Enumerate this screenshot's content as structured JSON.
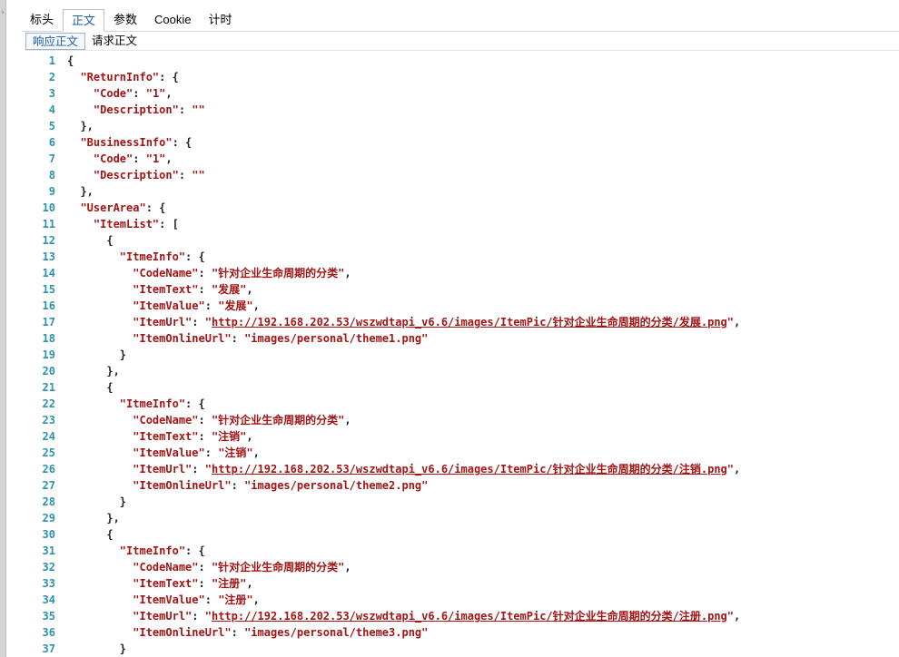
{
  "tabs": [
    {
      "label": "标头",
      "active": false
    },
    {
      "label": "正文",
      "active": true
    },
    {
      "label": "参数",
      "active": false
    },
    {
      "label": "Cookie",
      "active": false
    },
    {
      "label": "计时",
      "active": false
    }
  ],
  "subtabs": [
    {
      "label": "响应正文",
      "active": true
    },
    {
      "label": "请求正文",
      "active": false
    }
  ],
  "colors": {
    "key": "#a31515",
    "string": "#a31515",
    "line_number": "#2b91af",
    "active_tab": "#1e5cad"
  },
  "code_lines": [
    {
      "n": "1",
      "parts": [
        {
          "t": "p",
          "v": "{"
        }
      ]
    },
    {
      "n": "2",
      "parts": [
        {
          "t": "p",
          "v": "  "
        },
        {
          "t": "k",
          "v": "\"ReturnInfo\""
        },
        {
          "t": "p",
          "v": ": {"
        }
      ]
    },
    {
      "n": "3",
      "parts": [
        {
          "t": "p",
          "v": "    "
        },
        {
          "t": "k",
          "v": "\"Code\""
        },
        {
          "t": "p",
          "v": ": "
        },
        {
          "t": "s",
          "v": "\"1\""
        },
        {
          "t": "p",
          "v": ","
        }
      ]
    },
    {
      "n": "4",
      "parts": [
        {
          "t": "p",
          "v": "    "
        },
        {
          "t": "k",
          "v": "\"Description\""
        },
        {
          "t": "p",
          "v": ": "
        },
        {
          "t": "s",
          "v": "\"\""
        }
      ]
    },
    {
      "n": "5",
      "parts": [
        {
          "t": "p",
          "v": "  },"
        }
      ]
    },
    {
      "n": "6",
      "parts": [
        {
          "t": "p",
          "v": "  "
        },
        {
          "t": "k",
          "v": "\"BusinessInfo\""
        },
        {
          "t": "p",
          "v": ": {"
        }
      ]
    },
    {
      "n": "7",
      "parts": [
        {
          "t": "p",
          "v": "    "
        },
        {
          "t": "k",
          "v": "\"Code\""
        },
        {
          "t": "p",
          "v": ": "
        },
        {
          "t": "s",
          "v": "\"1\""
        },
        {
          "t": "p",
          "v": ","
        }
      ]
    },
    {
      "n": "8",
      "parts": [
        {
          "t": "p",
          "v": "    "
        },
        {
          "t": "k",
          "v": "\"Description\""
        },
        {
          "t": "p",
          "v": ": "
        },
        {
          "t": "s",
          "v": "\"\""
        }
      ]
    },
    {
      "n": "9",
      "parts": [
        {
          "t": "p",
          "v": "  },"
        }
      ]
    },
    {
      "n": "10",
      "parts": [
        {
          "t": "p",
          "v": "  "
        },
        {
          "t": "k",
          "v": "\"UserArea\""
        },
        {
          "t": "p",
          "v": ": {"
        }
      ]
    },
    {
      "n": "11",
      "parts": [
        {
          "t": "p",
          "v": "    "
        },
        {
          "t": "k",
          "v": "\"ItemList\""
        },
        {
          "t": "p",
          "v": ": ["
        }
      ]
    },
    {
      "n": "12",
      "parts": [
        {
          "t": "p",
          "v": "      {"
        }
      ]
    },
    {
      "n": "13",
      "parts": [
        {
          "t": "p",
          "v": "        "
        },
        {
          "t": "k",
          "v": "\"ItmeInfo\""
        },
        {
          "t": "p",
          "v": ": {"
        }
      ]
    },
    {
      "n": "14",
      "parts": [
        {
          "t": "p",
          "v": "          "
        },
        {
          "t": "k",
          "v": "\"CodeName\""
        },
        {
          "t": "p",
          "v": ": "
        },
        {
          "t": "s",
          "v": "\"针对企业生命周期的分类\""
        },
        {
          "t": "p",
          "v": ","
        }
      ]
    },
    {
      "n": "15",
      "parts": [
        {
          "t": "p",
          "v": "          "
        },
        {
          "t": "k",
          "v": "\"ItemText\""
        },
        {
          "t": "p",
          "v": ": "
        },
        {
          "t": "s",
          "v": "\"发展\""
        },
        {
          "t": "p",
          "v": ","
        }
      ]
    },
    {
      "n": "16",
      "parts": [
        {
          "t": "p",
          "v": "          "
        },
        {
          "t": "k",
          "v": "\"ItemValue\""
        },
        {
          "t": "p",
          "v": ": "
        },
        {
          "t": "s",
          "v": "\"发展\""
        },
        {
          "t": "p",
          "v": ","
        }
      ]
    },
    {
      "n": "17",
      "parts": [
        {
          "t": "p",
          "v": "          "
        },
        {
          "t": "k",
          "v": "\"ItemUrl\""
        },
        {
          "t": "p",
          "v": ": "
        },
        {
          "t": "s",
          "v": "\""
        },
        {
          "t": "u",
          "v": "http://192.168.202.53/wszwdtapi_v6.6/images/ItemPic/针对企业生命周期的分类/发展.png"
        },
        {
          "t": "s",
          "v": "\""
        },
        {
          "t": "p",
          "v": ","
        }
      ]
    },
    {
      "n": "18",
      "parts": [
        {
          "t": "p",
          "v": "          "
        },
        {
          "t": "k",
          "v": "\"ItemOnlineUrl\""
        },
        {
          "t": "p",
          "v": ": "
        },
        {
          "t": "s",
          "v": "\"images/personal/theme1.png\""
        }
      ]
    },
    {
      "n": "19",
      "parts": [
        {
          "t": "p",
          "v": "        }"
        }
      ]
    },
    {
      "n": "20",
      "parts": [
        {
          "t": "p",
          "v": "      },"
        }
      ]
    },
    {
      "n": "21",
      "parts": [
        {
          "t": "p",
          "v": "      {"
        }
      ]
    },
    {
      "n": "22",
      "parts": [
        {
          "t": "p",
          "v": "        "
        },
        {
          "t": "k",
          "v": "\"ItmeInfo\""
        },
        {
          "t": "p",
          "v": ": {"
        }
      ]
    },
    {
      "n": "23",
      "parts": [
        {
          "t": "p",
          "v": "          "
        },
        {
          "t": "k",
          "v": "\"CodeName\""
        },
        {
          "t": "p",
          "v": ": "
        },
        {
          "t": "s",
          "v": "\"针对企业生命周期的分类\""
        },
        {
          "t": "p",
          "v": ","
        }
      ]
    },
    {
      "n": "24",
      "parts": [
        {
          "t": "p",
          "v": "          "
        },
        {
          "t": "k",
          "v": "\"ItemText\""
        },
        {
          "t": "p",
          "v": ": "
        },
        {
          "t": "s",
          "v": "\"注销\""
        },
        {
          "t": "p",
          "v": ","
        }
      ]
    },
    {
      "n": "25",
      "parts": [
        {
          "t": "p",
          "v": "          "
        },
        {
          "t": "k",
          "v": "\"ItemValue\""
        },
        {
          "t": "p",
          "v": ": "
        },
        {
          "t": "s",
          "v": "\"注销\""
        },
        {
          "t": "p",
          "v": ","
        }
      ]
    },
    {
      "n": "26",
      "parts": [
        {
          "t": "p",
          "v": "          "
        },
        {
          "t": "k",
          "v": "\"ItemUrl\""
        },
        {
          "t": "p",
          "v": ": "
        },
        {
          "t": "s",
          "v": "\""
        },
        {
          "t": "u",
          "v": "http://192.168.202.53/wszwdtapi_v6.6/images/ItemPic/针对企业生命周期的分类/注销.png"
        },
        {
          "t": "s",
          "v": "\""
        },
        {
          "t": "p",
          "v": ","
        }
      ]
    },
    {
      "n": "27",
      "parts": [
        {
          "t": "p",
          "v": "          "
        },
        {
          "t": "k",
          "v": "\"ItemOnlineUrl\""
        },
        {
          "t": "p",
          "v": ": "
        },
        {
          "t": "s",
          "v": "\"images/personal/theme2.png\""
        }
      ]
    },
    {
      "n": "28",
      "parts": [
        {
          "t": "p",
          "v": "        }"
        }
      ]
    },
    {
      "n": "29",
      "parts": [
        {
          "t": "p",
          "v": "      },"
        }
      ]
    },
    {
      "n": "30",
      "parts": [
        {
          "t": "p",
          "v": "      {"
        }
      ]
    },
    {
      "n": "31",
      "parts": [
        {
          "t": "p",
          "v": "        "
        },
        {
          "t": "k",
          "v": "\"ItmeInfo\""
        },
        {
          "t": "p",
          "v": ": {"
        }
      ]
    },
    {
      "n": "32",
      "parts": [
        {
          "t": "p",
          "v": "          "
        },
        {
          "t": "k",
          "v": "\"CodeName\""
        },
        {
          "t": "p",
          "v": ": "
        },
        {
          "t": "s",
          "v": "\"针对企业生命周期的分类\""
        },
        {
          "t": "p",
          "v": ","
        }
      ]
    },
    {
      "n": "33",
      "parts": [
        {
          "t": "p",
          "v": "          "
        },
        {
          "t": "k",
          "v": "\"ItemText\""
        },
        {
          "t": "p",
          "v": ": "
        },
        {
          "t": "s",
          "v": "\"注册\""
        },
        {
          "t": "p",
          "v": ","
        }
      ]
    },
    {
      "n": "34",
      "parts": [
        {
          "t": "p",
          "v": "          "
        },
        {
          "t": "k",
          "v": "\"ItemValue\""
        },
        {
          "t": "p",
          "v": ": "
        },
        {
          "t": "s",
          "v": "\"注册\""
        },
        {
          "t": "p",
          "v": ","
        }
      ]
    },
    {
      "n": "35",
      "parts": [
        {
          "t": "p",
          "v": "          "
        },
        {
          "t": "k",
          "v": "\"ItemUrl\""
        },
        {
          "t": "p",
          "v": ": "
        },
        {
          "t": "s",
          "v": "\""
        },
        {
          "t": "u",
          "v": "http://192.168.202.53/wszwdtapi_v6.6/images/ItemPic/针对企业生命周期的分类/注册.png"
        },
        {
          "t": "s",
          "v": "\""
        },
        {
          "t": "p",
          "v": ","
        }
      ]
    },
    {
      "n": "36",
      "parts": [
        {
          "t": "p",
          "v": "          "
        },
        {
          "t": "k",
          "v": "\"ItemOnlineUrl\""
        },
        {
          "t": "p",
          "v": ": "
        },
        {
          "t": "s",
          "v": "\"images/personal/theme3.png\""
        }
      ]
    },
    {
      "n": "37",
      "parts": [
        {
          "t": "p",
          "v": "        }"
        }
      ]
    }
  ]
}
